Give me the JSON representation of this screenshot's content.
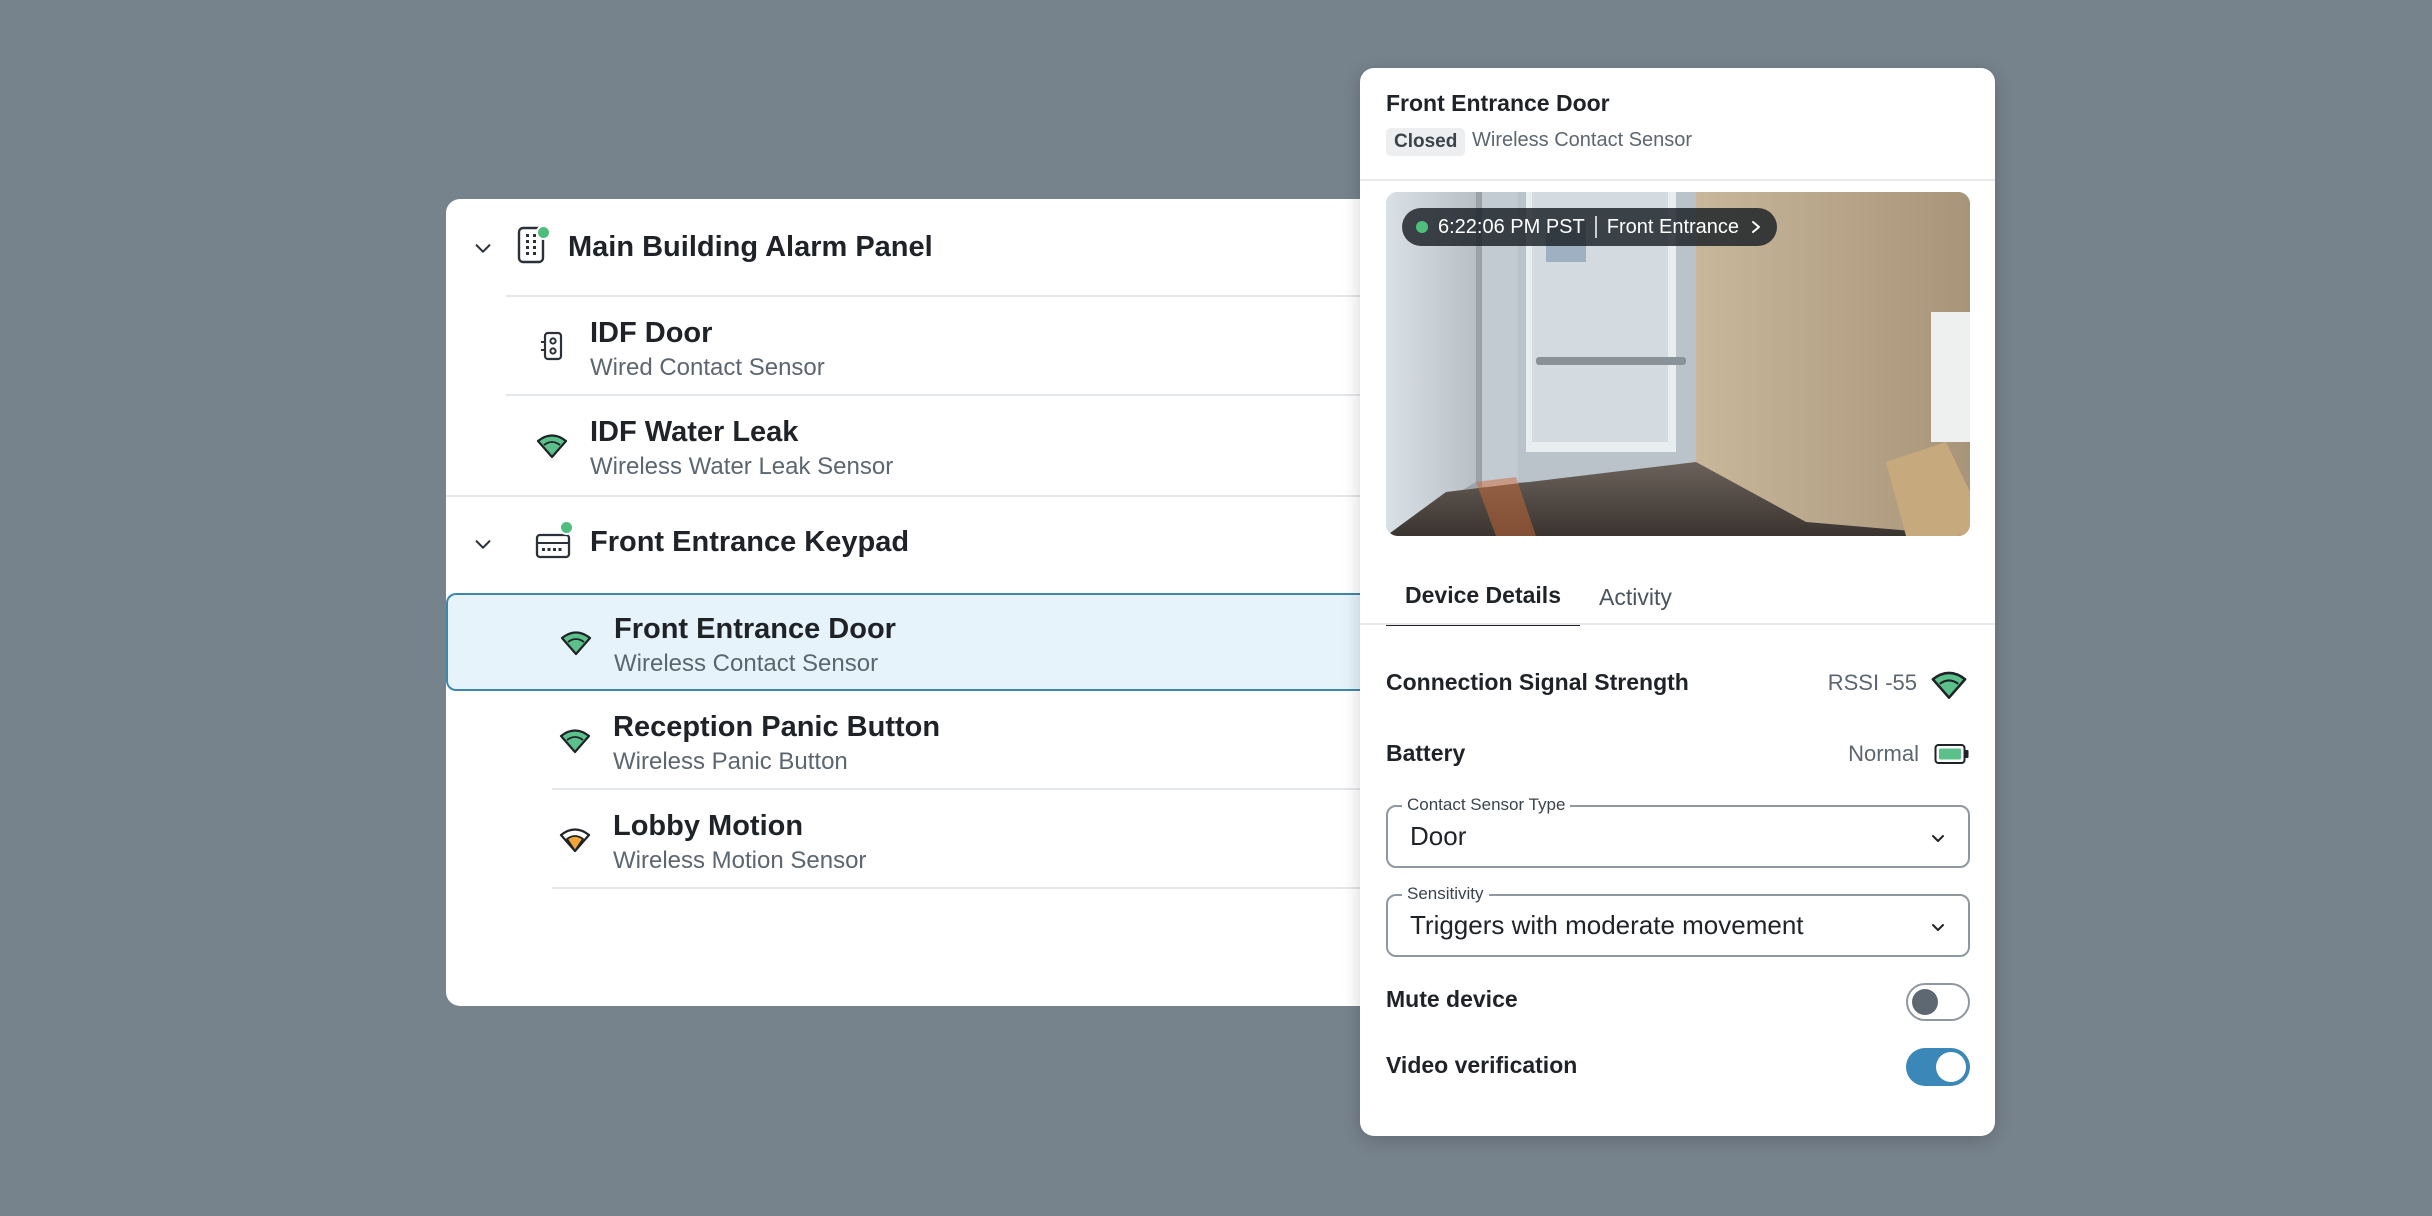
{
  "tree": {
    "groups": [
      {
        "title": "Main Building Alarm Panel",
        "icon": "alarm-panel-icon",
        "online": true,
        "children": [
          {
            "title": "IDF Door",
            "subtitle": "Wired Contact Sensor",
            "icon": "wired-sensor-icon"
          },
          {
            "title": "IDF Water Leak",
            "subtitle": "Wireless Water Leak Sensor",
            "icon": "wireless-signal-strong-icon"
          }
        ]
      },
      {
        "title": "Front Entrance Keypad",
        "icon": "keypad-icon",
        "online": true,
        "children": [
          {
            "title": "Front Entrance Door",
            "subtitle": "Wireless Contact Sensor",
            "icon": "wireless-signal-strong-icon",
            "selected": true
          },
          {
            "title": "Reception Panic Button",
            "subtitle": "Wireless Panic Button",
            "icon": "wireless-signal-strong-icon"
          },
          {
            "title": "Lobby Motion",
            "subtitle": "Wireless Motion Sensor",
            "icon": "wireless-signal-weak-icon"
          }
        ]
      }
    ]
  },
  "panel": {
    "title": "Front Entrance Door",
    "status_badge": "Closed",
    "device_type": "Wireless Contact Sensor",
    "camera": {
      "timestamp": "6:22:06 PM PST",
      "camera_name": "Front Entrance"
    },
    "tabs": [
      {
        "label": "Device Details",
        "active": true
      },
      {
        "label": "Activity",
        "active": false
      }
    ],
    "details": {
      "signal_label": "Connection Signal Strength",
      "signal_value": "RSSI -55",
      "battery_label": "Battery",
      "battery_value": "Normal",
      "contact_type_label": "Contact Sensor Type",
      "contact_type_value": "Door",
      "sensitivity_label": "Sensitivity",
      "sensitivity_value": "Triggers with moderate movement",
      "mute_label": "Mute device",
      "mute_on": false,
      "video_label": "Video verification",
      "video_on": true
    }
  },
  "colors": {
    "background": "#76828c",
    "online_green": "#4fbd7b",
    "signal_green": "#5cc08a",
    "signal_warn": "#f0a43a",
    "selected_bg": "#e6f3fa",
    "selected_border": "#3f86ad",
    "toggle_on": "#3a87b8"
  }
}
